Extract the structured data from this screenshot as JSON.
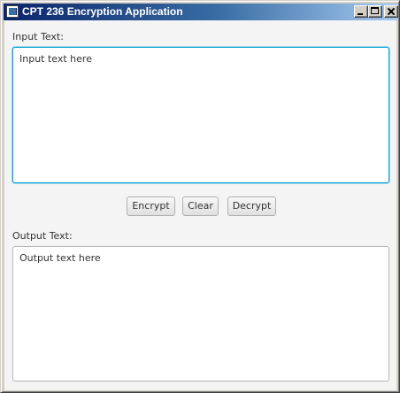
{
  "window": {
    "title": "CPT 236 Encryption Application"
  },
  "input": {
    "label": "Input Text:",
    "placeholder": "Input text here",
    "value": ""
  },
  "buttons": {
    "encrypt": "Encrypt",
    "clear": "Clear",
    "decrypt": "Decrypt"
  },
  "output": {
    "label": "Output Text:",
    "placeholder": "Output text here",
    "value": ""
  },
  "icons": {
    "app": "app-icon",
    "minimize": "minimize-icon",
    "maximize": "maximize-icon",
    "close": "close-icon"
  },
  "colors": {
    "titlebar_start": "#0a246a",
    "titlebar_end": "#a6caf0",
    "focus_border": "#039ed3",
    "content_background": "#f4f4f4"
  }
}
